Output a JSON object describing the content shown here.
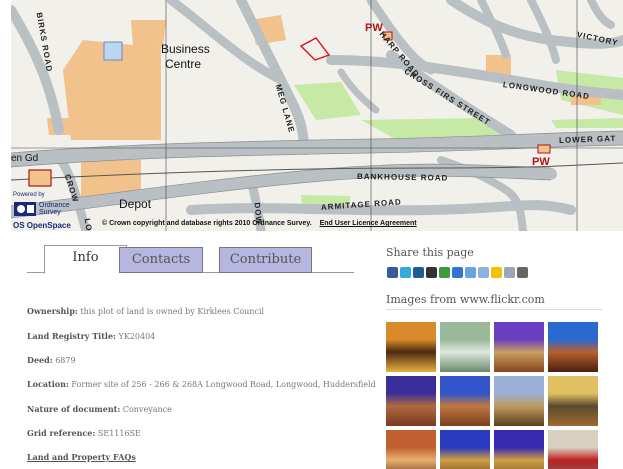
{
  "map": {
    "labels": {
      "business_centre_line1": "Business",
      "business_centre_line2": "Centre",
      "depot": "Depot",
      "en_gd": "en Gd",
      "pw_top": "PW",
      "pw_bottom": "PW"
    },
    "roads": {
      "birks_road": "BIRKS ROAD",
      "harp_road": "HARP ROAD",
      "victory": "VICTORY",
      "longwood_road": "LONGWOOD ROAD",
      "cross_firs_street": "CROSS FIRS STREET",
      "meg_lane": "MEG LANE",
      "lower_gate": "LOWER GAT",
      "bankhouse_road": "BANKHOUSE ROAD",
      "armitage_road": "ARMITAGE ROAD",
      "crow": "CROW",
      "dow": "DOW",
      "lo": "LO"
    },
    "os_logo": {
      "powered_by": "Powered by",
      "ordnance": "Ordnance",
      "survey": "Survey",
      "openspace": "OS OpenSpace"
    },
    "copyright_text": "© Crown copyright and database rights 2010 Ordnance Survey.",
    "licence_link": "End User Licence Agreement"
  },
  "tabs": [
    {
      "label": "Info",
      "active": true
    },
    {
      "label": "Contacts",
      "active": false
    },
    {
      "label": "Contribute",
      "active": false
    }
  ],
  "info": {
    "ownership_label": "Ownership:",
    "ownership_value": "this plot of land is owned by Kirklees Council",
    "land_registry_label": "Land Registry Title:",
    "land_registry_value": "YK20404",
    "deed_label": "Deed:",
    "deed_value": "6879",
    "location_label": "Location:",
    "location_value": "Former site of 256 - 266 & 268A Longwood Road, Longwood, Huddersfield",
    "nature_label": "Nature of document:",
    "nature_value": "Conveyance",
    "grid_label": "Grid reference:",
    "grid_value": "SE1116SE",
    "faq_link": "Land and Property FAQs"
  },
  "share": {
    "title": "Share this page",
    "icons": [
      {
        "name": "facebook-icon",
        "color": "#3b5998"
      },
      {
        "name": "twitter-icon",
        "color": "#33aadd"
      },
      {
        "name": "digg-icon",
        "color": "#1d5d95"
      },
      {
        "name": "myspace-icon",
        "color": "#333333"
      },
      {
        "name": "stumbleupon-icon",
        "color": "#3d9a3d"
      },
      {
        "name": "delicious-icon",
        "color": "#3274d0"
      },
      {
        "name": "google-icon",
        "color": "#66a3e0"
      },
      {
        "name": "reddit-icon",
        "color": "#8ab4e0"
      },
      {
        "name": "favorite-star-icon",
        "color": "#f2c200"
      },
      {
        "name": "email-icon",
        "color": "#9aa7b8"
      },
      {
        "name": "print-icon",
        "color": "#666666"
      }
    ]
  },
  "flickr": {
    "title": "Images from www.flickr.com",
    "thumbs": [
      {
        "name": "flickr-thumb-1",
        "colors": [
          "#d98a2a",
          "#4a2a10",
          "#e8b040"
        ]
      },
      {
        "name": "flickr-thumb-2",
        "colors": [
          "#9ab99a",
          "#dde8dd",
          "#6c8a6c"
        ]
      },
      {
        "name": "flickr-thumb-3",
        "colors": [
          "#6a3fbf",
          "#c8a060",
          "#8a4520"
        ]
      },
      {
        "name": "flickr-thumb-4",
        "colors": [
          "#2a6ad0",
          "#b86030",
          "#4a2010"
        ]
      },
      {
        "name": "flickr-thumb-5",
        "colors": [
          "#3a2f9a",
          "#b06a40",
          "#7a3a20"
        ]
      },
      {
        "name": "flickr-thumb-6",
        "colors": [
          "#3355cc",
          "#c07840",
          "#7a4020"
        ]
      },
      {
        "name": "flickr-thumb-7",
        "colors": [
          "#9ab0d8",
          "#c09a60",
          "#5a4020"
        ]
      },
      {
        "name": "flickr-thumb-8",
        "colors": [
          "#e0c060",
          "#5a4a30",
          "#a06a30"
        ]
      },
      {
        "name": "flickr-thumb-9",
        "colors": [
          "#c06030",
          "#e8b070",
          "#602a10"
        ]
      },
      {
        "name": "flickr-thumb-10",
        "colors": [
          "#2a3ac0",
          "#d0a040",
          "#6a4020"
        ]
      },
      {
        "name": "flickr-thumb-11",
        "colors": [
          "#3a2ab0",
          "#d0a040",
          "#7a5030"
        ]
      },
      {
        "name": "flickr-thumb-12",
        "colors": [
          "#d8d0c0",
          "#c02020",
          "#6a6a6a"
        ]
      }
    ]
  }
}
